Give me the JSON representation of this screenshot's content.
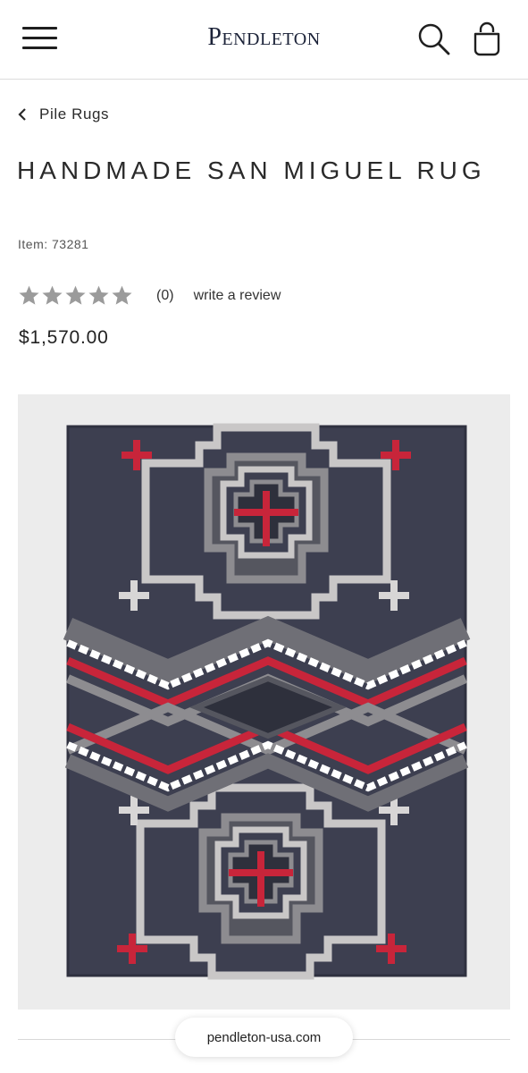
{
  "header": {
    "brand": "Pendleton",
    "menu_icon": "hamburger-menu-icon",
    "search_icon": "search-icon",
    "bag_icon": "shopping-bag-icon"
  },
  "breadcrumb": {
    "label": "Pile Rugs",
    "icon": "chevron-left-icon"
  },
  "product": {
    "title": "HANDMADE SAN MIGUEL RUG",
    "item_number": "Item: 73281",
    "rating": {
      "stars": 5,
      "filled": 0,
      "count_label": "(0)",
      "review_link": "write a review"
    },
    "price": "$1,570.00",
    "image_icon": "rug-product-image"
  },
  "browser": {
    "url": "pendleton-usa.com"
  },
  "colors": {
    "rug_background": "#3d3f50",
    "rug_red": "#c8253a",
    "rug_light_gray": "#c9c7c7",
    "rug_mid_gray": "#8d8c90",
    "star_gray": "#9b9b9b",
    "brand_navy": "#1b2238"
  }
}
